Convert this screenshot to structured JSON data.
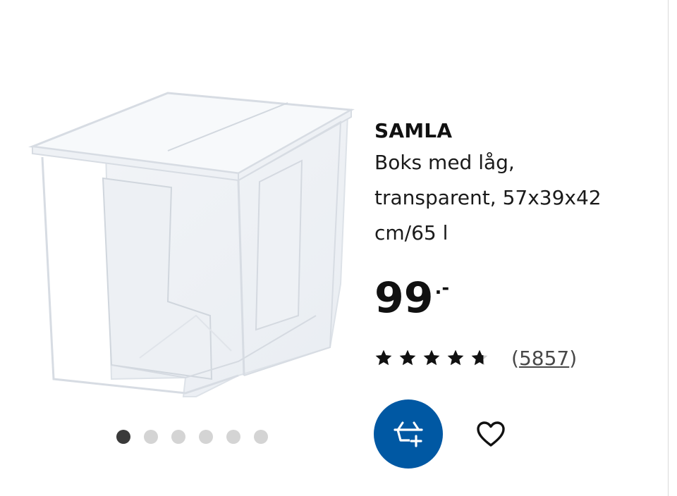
{
  "product": {
    "name": "SAMLA",
    "description_lines": [
      "Boks med låg,",
      "transparent, 57x39x42",
      "cm/65 l"
    ],
    "price": "99",
    "price_suffix": ".-",
    "rating_value": 4.5,
    "rating_max": 5,
    "reviews_open": "(",
    "reviews_count": "5857",
    "reviews_close": ")"
  },
  "gallery": {
    "image_count": 6,
    "active_index": 0
  },
  "actions": {
    "add_to_cart_icon": "basket-plus-icon",
    "favourite_icon": "heart-outline-icon"
  },
  "colors": {
    "brand_blue": "#0058a3",
    "dot_active": "#3a3a3a",
    "dot_inactive": "#d4d4d4",
    "text": "#111111"
  }
}
